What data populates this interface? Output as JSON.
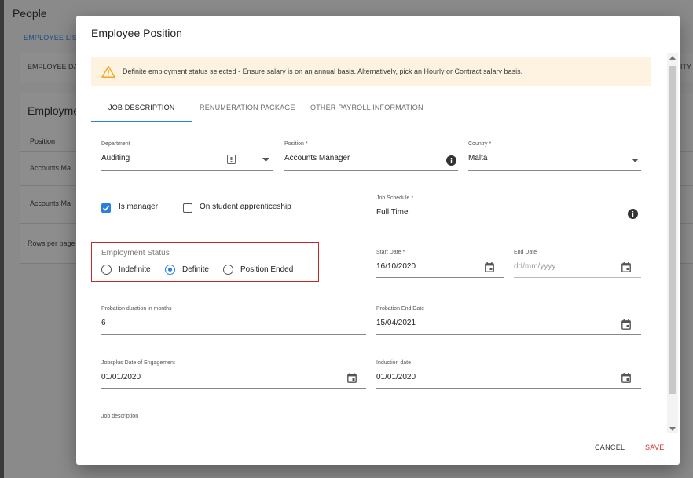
{
  "background": {
    "title": "People",
    "tab": "EMPLOYEE LIST",
    "card1_text": "EMPLOYEE DA",
    "card1_right": "ITY",
    "card2_title": "Employme",
    "column": "Position",
    "rows": [
      "Accounts Ma",
      "Accounts Ma"
    ],
    "rows_per_page": "Rows per page"
  },
  "dialog": {
    "title": "Employee Position",
    "alert": {
      "icon": "warning-icon",
      "text": "Definite employment status selected - Ensure salary is on an annual basis. Alternatively, pick an Hourly or Contract salary basis."
    },
    "tabs": [
      {
        "label": "JOB DESCRIPTION",
        "active": true
      },
      {
        "label": "RENUMERATION PACKAGE",
        "active": false
      },
      {
        "label": "OTHER PAYROLL INFORMATION",
        "active": false
      }
    ],
    "fields": {
      "department": {
        "label": "Department",
        "value": "Auditing"
      },
      "position": {
        "label": "Position *",
        "value": "Accounts Manager"
      },
      "country": {
        "label": "Country *",
        "value": "Malta"
      },
      "job_schedule": {
        "label": "Job Schedule *",
        "value": "Full Time"
      },
      "start_date": {
        "label": "Start Date *",
        "value": "16/10/2020"
      },
      "end_date": {
        "label": "End Date",
        "placeholder": "dd/mm/yyyy"
      },
      "probation_duration": {
        "label": "Probation duration in months",
        "value": "6"
      },
      "probation_end": {
        "label": "Probation End Date",
        "value": "15/04/2021"
      },
      "jobsplus_date": {
        "label": "Jobsplus Date of Engagement",
        "value": "01/01/2020"
      },
      "induction_date": {
        "label": "Induction date",
        "value": "01/01/2020"
      },
      "job_description": {
        "label": "Job description"
      }
    },
    "checkboxes": {
      "is_manager": {
        "label": "Is manager",
        "checked": true
      },
      "apprenticeship": {
        "label": "On student apprenticeship",
        "checked": false
      }
    },
    "employment_status": {
      "title": "Employment Status",
      "options": [
        "Indefinite",
        "Definite",
        "Position Ended"
      ],
      "selected": "Definite"
    },
    "buttons": {
      "cancel": "CANCEL",
      "save": "SAVE"
    },
    "colors": {
      "accent": "#2a7de1",
      "danger": "#d32f2f",
      "alert_bg": "#fdf3e0",
      "warning": "#f5a623"
    }
  }
}
